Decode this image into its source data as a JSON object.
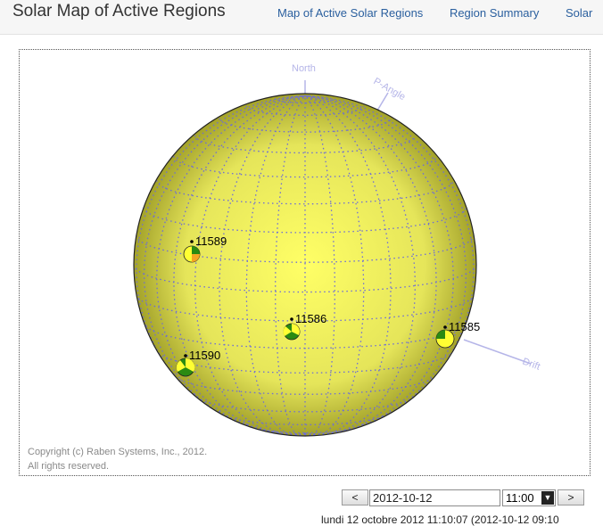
{
  "header": {
    "title": "Solar Map of Active Regions",
    "nav": [
      "Map of Active Solar Regions",
      "Region Summary",
      "Solar"
    ]
  },
  "map": {
    "labels": {
      "north": "North",
      "p_angle": "P-Angle",
      "drift": "Drift"
    },
    "regions": [
      {
        "id": "11589",
        "colors": [
          "#ffff33",
          "#2a8a12",
          "#f5a623"
        ]
      },
      {
        "id": "11586",
        "colors": [
          "#2a8a12",
          "#ffff33",
          "#2a8a12"
        ]
      },
      {
        "id": "11585",
        "colors": [
          "#ffff33",
          "#2a8a12"
        ]
      },
      {
        "id": "11590",
        "colors": [
          "#2a8a12",
          "#ffff33",
          "#2a8a12"
        ]
      }
    ],
    "copyright_line1": "Copyright (c) Raben Systems, Inc., 2012.",
    "copyright_line2": "All rights reserved."
  },
  "controls": {
    "prev": "<",
    "date": "2012-10-12",
    "time": "11:00",
    "next": ">"
  },
  "footer": {
    "text": "lundi 12 octobre 2012 11:10:07 (2012-10-12 09:10"
  },
  "colors": {
    "nav_link": "#2a5f9e",
    "sun_center": "#ffff66",
    "sun_edge": "#a0a020",
    "grid": "#6c6cd8"
  }
}
